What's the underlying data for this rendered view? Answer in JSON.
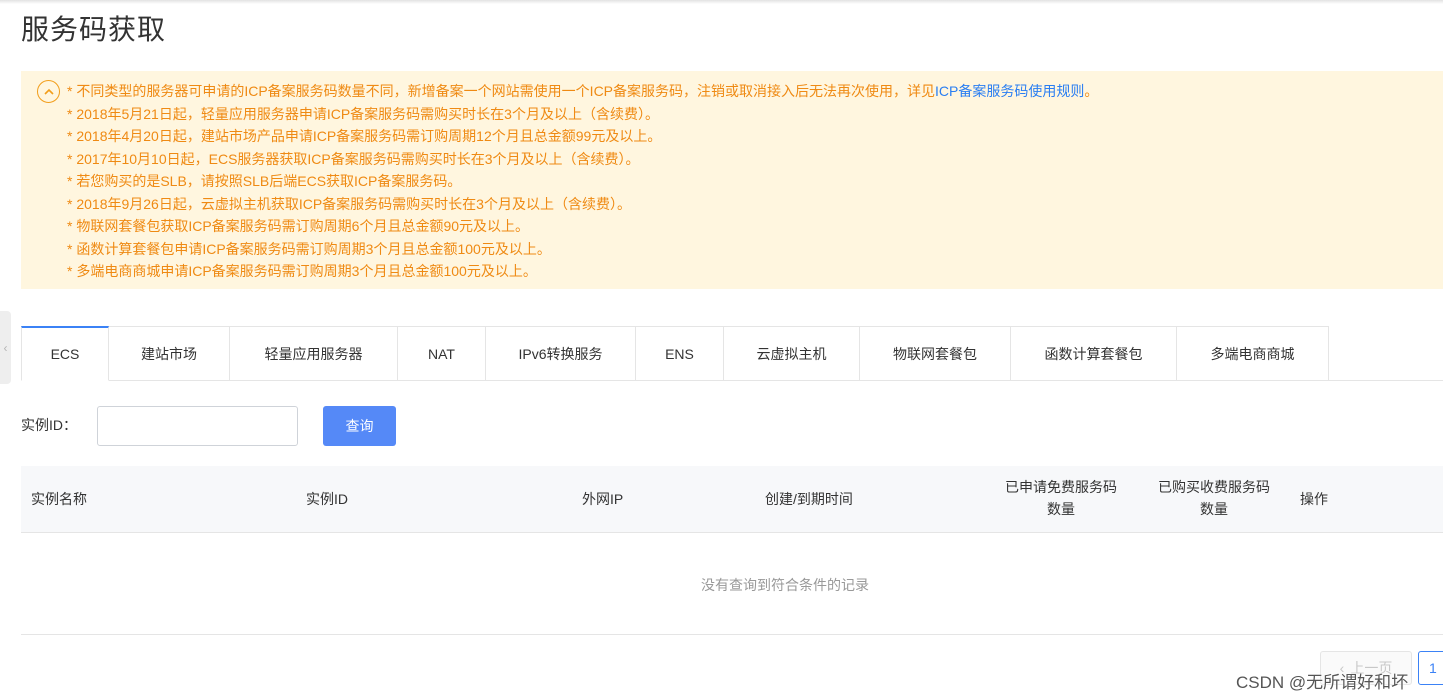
{
  "page": {
    "title": "服务码获取"
  },
  "notice": {
    "lines": [
      "* 不同类型的服务器可申请的ICP备案服务码数量不同，新增备案一个网站需使用一个ICP备案服务码，注销或取消接入后无法再次使用，详见",
      "* 2018年5月21日起，轻量应用服务器申请ICP备案服务码需购买时长在3个月及以上（含续费）。",
      "* 2018年4月20日起，建站市场产品申请ICP备案服务码需订购周期12个月且总金额99元及以上。",
      "* 2017年10月10日起，ECS服务器获取ICP备案服务码需购买时长在3个月及以上（含续费）。",
      "* 若您购买的是SLB，请按照SLB后端ECS获取ICP备案服务码。",
      "* 2018年9月26日起，云虚拟主机获取ICP备案服务码需购买时长在3个月及以上（含续费）。",
      "* 物联网套餐包获取ICP备案服务码需订购周期6个月且总金额90元及以上。",
      "* 函数计算套餐包申请ICP备案服务码需订购周期3个月且总金额100元及以上。",
      "* 多端电商商城申请ICP备案服务码需订购周期3个月且总金额100元及以上。"
    ],
    "link_text": "ICP备案服务码使用规则",
    "link_suffix": "。",
    "link_color": "#2a7ef2",
    "text_color": "#ef8a13",
    "bg_color": "#fff6df"
  },
  "tabs": [
    {
      "label": "ECS",
      "active": true
    },
    {
      "label": "建站市场"
    },
    {
      "label": "轻量应用服务器"
    },
    {
      "label": "NAT"
    },
    {
      "label": "IPv6转换服务"
    },
    {
      "label": "ENS"
    },
    {
      "label": "云虚拟主机"
    },
    {
      "label": "物联网套餐包"
    },
    {
      "label": "函数计算套餐包"
    },
    {
      "label": "多端电商商城"
    }
  ],
  "search": {
    "label": "实例ID：",
    "value": "",
    "placeholder": "",
    "button": "查询"
  },
  "table": {
    "columns": {
      "name": "实例名称",
      "id": "实例ID",
      "ip": "外网IP",
      "time": "创建/到期时间",
      "free_line1": "已申请免费服务码",
      "free_line2": "数量",
      "paid_line1": "已购买收费服务码",
      "paid_line2": "数量",
      "action": "操作"
    },
    "rows": [],
    "empty_text": "没有查询到符合条件的记录"
  },
  "pagination": {
    "prev_label": "上一页",
    "current_page": "1"
  },
  "watermark": "CSDN @无所谓好和坏",
  "colors": {
    "accent": "#3b82f6",
    "button": "#5589f7"
  }
}
